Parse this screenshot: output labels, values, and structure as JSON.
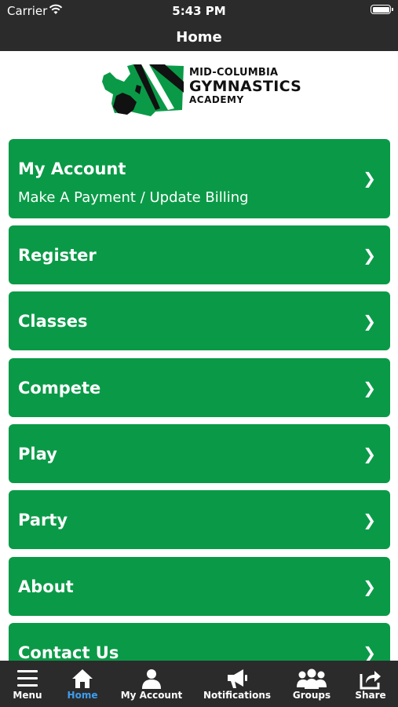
{
  "status_bar": {
    "carrier": "Carrier",
    "time": "5:43 PM"
  },
  "nav": {
    "title": "Home"
  },
  "logo": {
    "line1": "MID-COLUMBIA",
    "line2": "GYMNASTICS",
    "line3": "ACADEMY"
  },
  "menu": {
    "items": [
      {
        "label": "My Account",
        "sublabel": "Make A Payment / Update Billing"
      },
      {
        "label": "Register"
      },
      {
        "label": "Classes"
      },
      {
        "label": "Compete"
      },
      {
        "label": "Play"
      },
      {
        "label": "Party"
      },
      {
        "label": "About"
      },
      {
        "label": "Contact Us"
      }
    ],
    "chevron": "❯"
  },
  "tabs": [
    {
      "label": "Menu",
      "icon": "hamburger-icon"
    },
    {
      "label": "Home",
      "icon": "home-icon",
      "active": true
    },
    {
      "label": "My Account",
      "icon": "person-icon"
    },
    {
      "label": "Notifications",
      "icon": "megaphone-icon"
    },
    {
      "label": "Groups",
      "icon": "group-icon"
    },
    {
      "label": "Share",
      "icon": "share-icon"
    }
  ],
  "colors": {
    "bar": "#2b2b2b",
    "button_green": "#0a9a47",
    "active_tab": "#3d9df0"
  }
}
